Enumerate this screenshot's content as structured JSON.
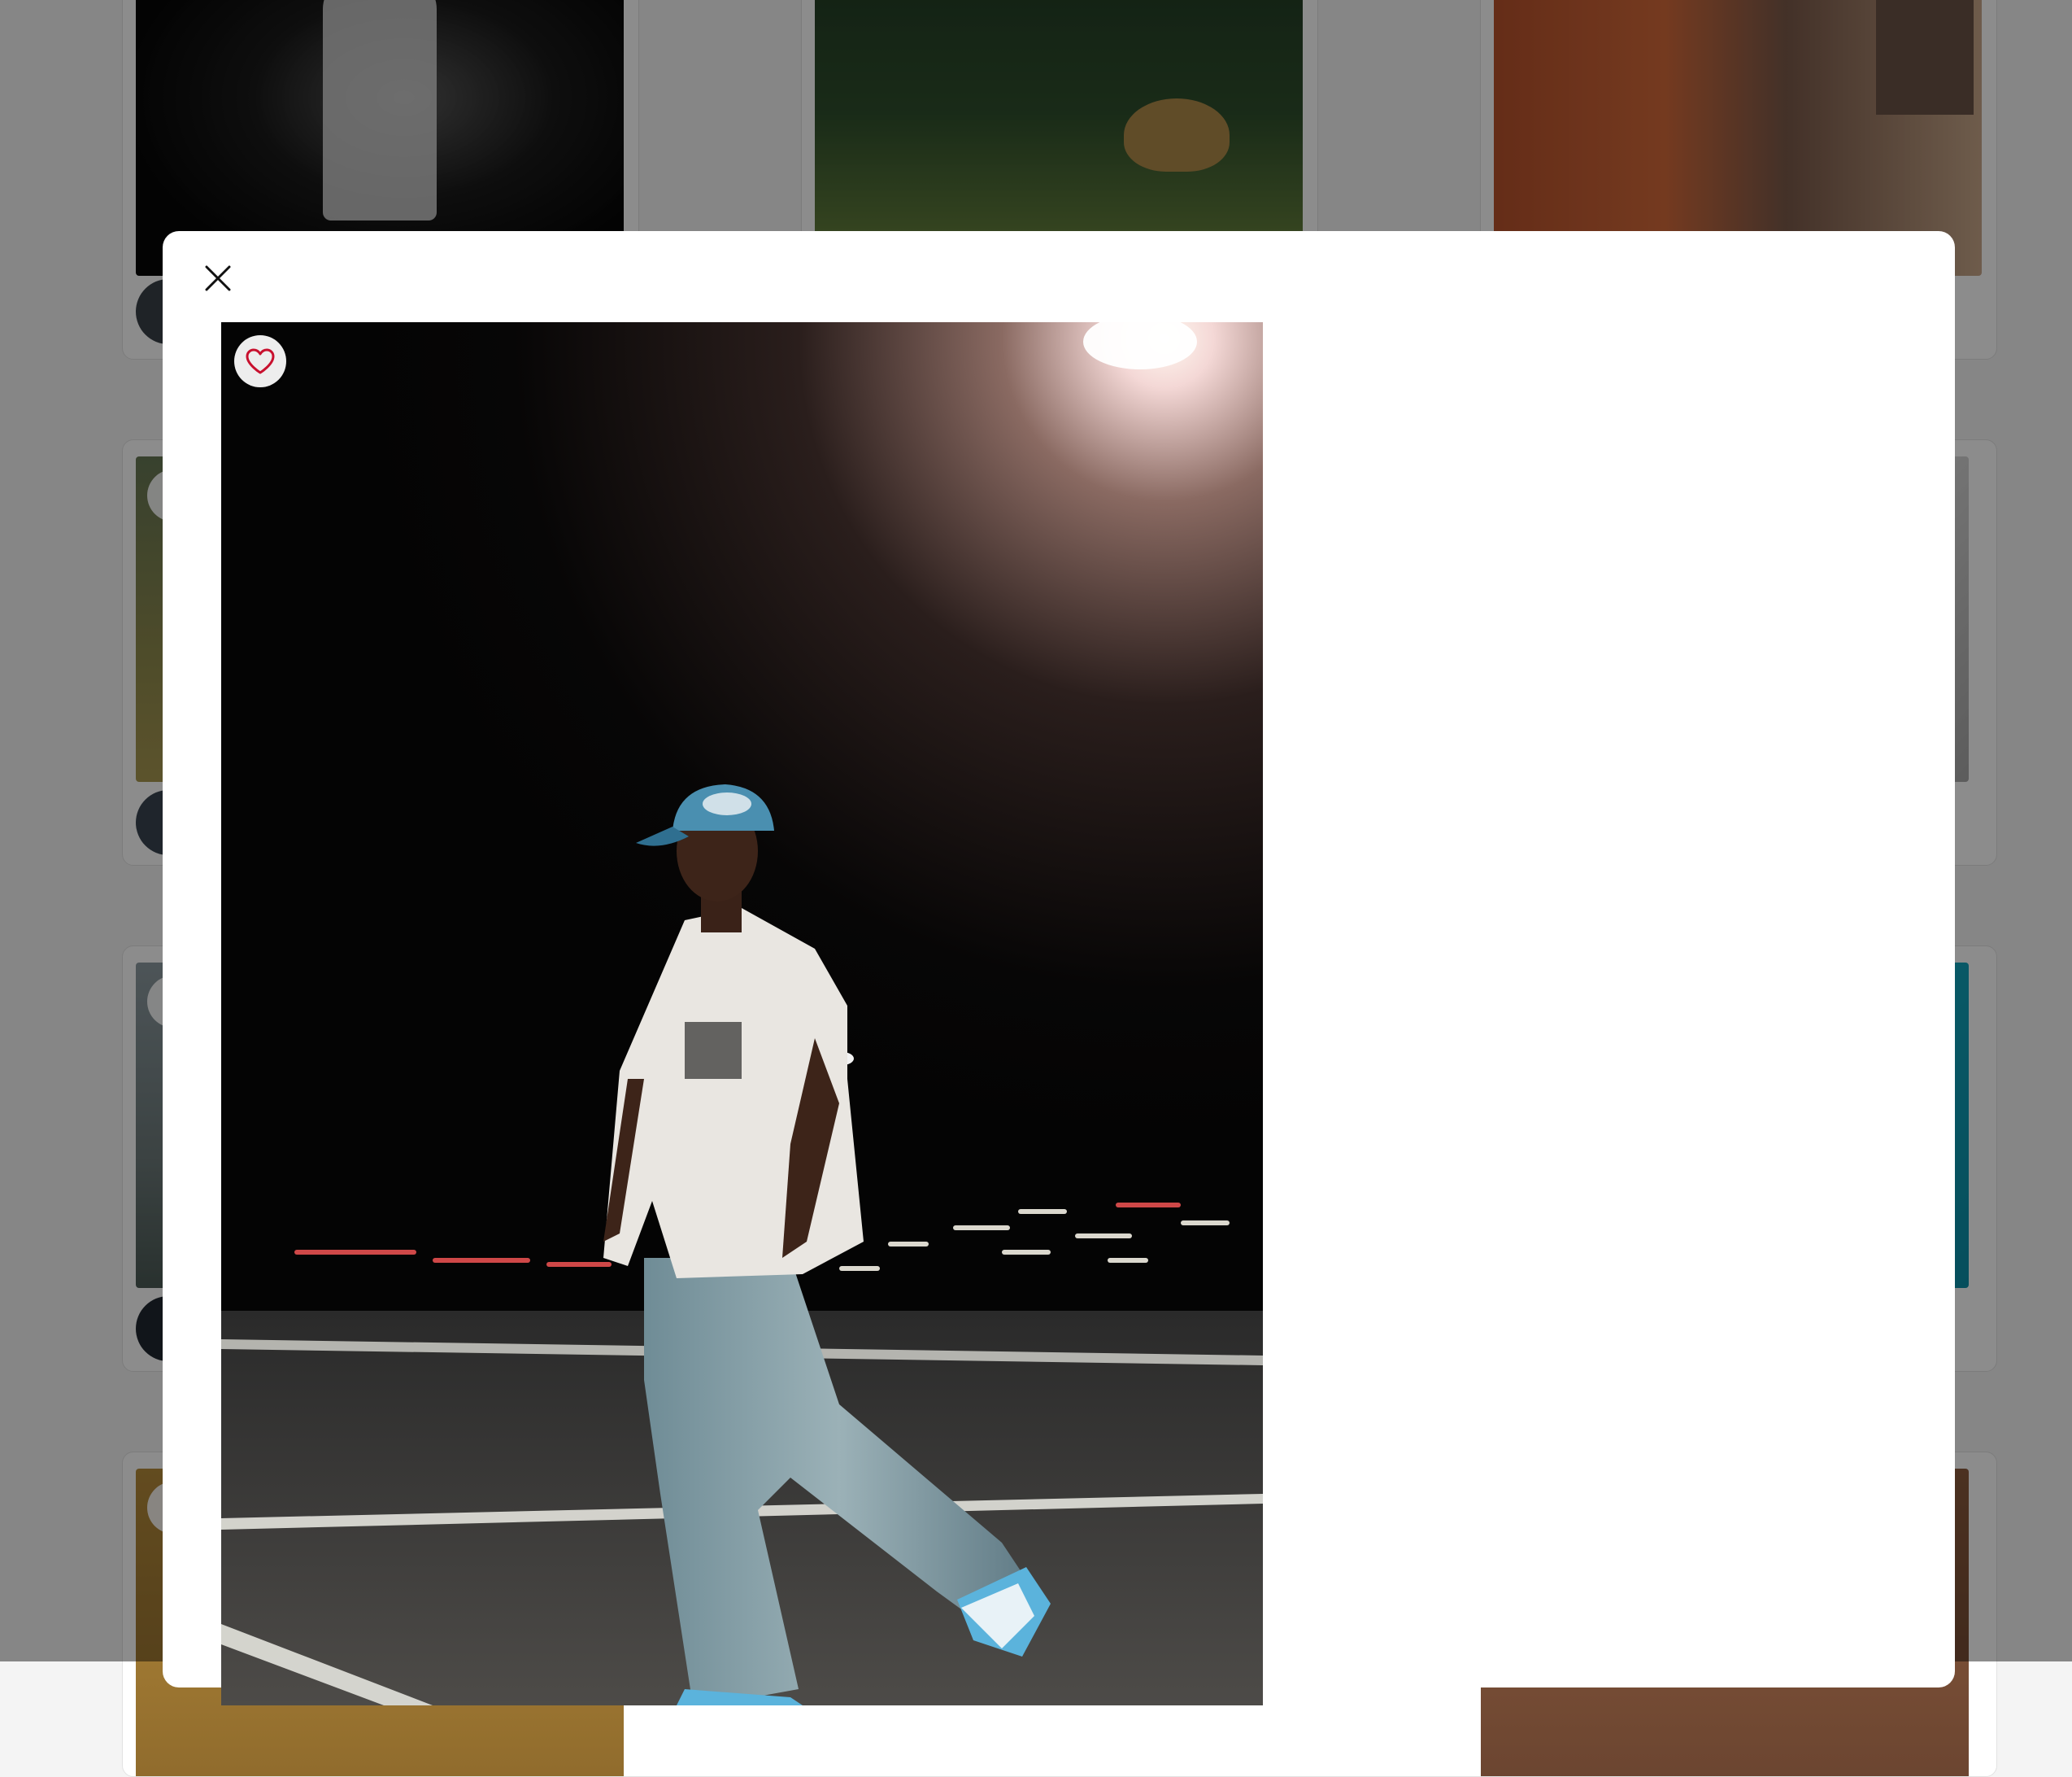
{
  "theme": {
    "accent_like": "#c8102e",
    "overlay": "rgba(0,0,0,0.45)",
    "modal_background": "#ffffff"
  },
  "gallery": {
    "cards": [
      {
        "subject": "man-in-cap-at-night"
      },
      {
        "subject": "jaguar-in-grass"
      },
      {
        "subject": "orange-buildings-with-spires"
      },
      {
        "subject": "grassy-field"
      },
      {
        "subject": "light-grey-scene"
      },
      {
        "subject": "coastline"
      },
      {
        "subject": "turquoise-sea"
      },
      {
        "subject": "warm-brown-interior"
      },
      {
        "subject": "brown-interior"
      }
    ]
  },
  "modal": {
    "close_icon": "close-icon",
    "like_icon": "heart-icon",
    "photo_subject": "man-in-blue-cap-walking-on-road-at-night"
  }
}
